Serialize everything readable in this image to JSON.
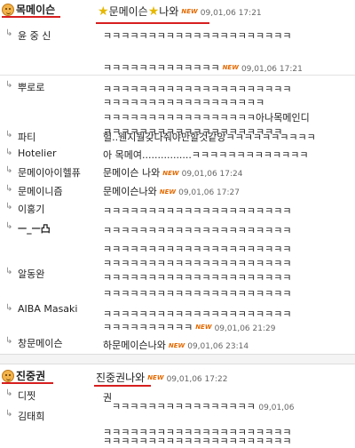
{
  "colors": {
    "underline": "#d71e1e",
    "new_badge": "#e46a00",
    "star": "#e6b800"
  },
  "icons": {
    "author": "smiley-face-icon",
    "reply": "reply-arrow-icon",
    "star": "star-icon"
  },
  "thread1": {
    "author": "목메이슨",
    "title_a": "문메이슨",
    "title_b": "나와",
    "new": "NEW",
    "time": "09,01,06 17:21",
    "replies": [
      {
        "name": "윤 중 신",
        "text": "ㅋㅋㅋㅋㅋㅋㅋㅋㅋㅋㅋㅋㅋㅋㅋㅋㅋㅋㅋㅋㅋ",
        "text2": "ㅋㅋㅋㅋㅋㅋㅋㅋㅋㅋㅋㅋㅋ",
        "new": "NEW",
        "time": "09,01,06 17:21"
      },
      {
        "name": "뿌로로",
        "text": "ㅋㅋㅋㅋㅋㅋㅋㅋㅋㅋㅋㅋㅋㅋㅋㅋㅋㅋㅋㅋㅋ",
        "text2": "ㅋㅋㅋㅋㅋㅋㅋㅋㅋㅋㅋㅋㅋㅋㅋㅋㅋㅋ",
        "text3": "ㅋㅋㅋㅋㅋㅋㅋㅋㅋㅋㅋㅋㅋㅋㅋㅋㅋ아나목메인디",
        "text4": "ㅋㅋㅋㅋㅋㅋㅋㅋㅋㅋㅋㅋㅋㅋㅋㅋㅋㅋㅋㅋ"
      },
      {
        "name": "파티",
        "text": "헐..웬지뭘갖다줘야만할것같앙ㅋㅋㅋㅋㅋㅋㅋㅋㅋㅋ"
      },
      {
        "name": "Hotelier",
        "text": "아 목메여................ㅋㅋㅋㅋㅋㅋㅋㅋㅋㅋㅋㅋㅋ"
      },
      {
        "name": "문메이아이헬퓨",
        "text": "문메이슨 나와",
        "new": "NEW",
        "time": "09,01,06 17:24"
      },
      {
        "name": "문메이니즘",
        "text": "문메이슨나와",
        "new": "NEW",
        "time": "09,01,06 17:27"
      },
      {
        "name": "이홍기",
        "text": "ㅋㅋㅋㅋㅋㅋㅋㅋㅋㅋㅋㅋㅋㅋㅋㅋㅋㅋㅋㅋㅋ"
      },
      {
        "name": "ㅡ_ㅡ凸",
        "text": "ㅋㅋㅋㅋㅋㅋㅋㅋㅋㅋㅋㅋㅋㅋㅋㅋㅋㅋㅋㅋㅋ",
        "text2": "ㅋㅋㅋㅋㅋㅋㅋㅋㅋㅋㅋㅋㅋㅋㅋㅋㅋㅋㅋㅋㅋ",
        "text3": "ㅋㅋㅋㅋㅋㅋㅋㅋㅋㅋㅋㅋㅋㅋㅋㅋㅋㅋㅋㅋㅋ"
      },
      {
        "name": "알동완",
        "text": "ㅋㅋㅋㅋㅋㅋㅋㅋㅋㅋㅋㅋㅋㅋㅋㅋㅋㅋㅋㅋㅋ",
        "text2": "ㅋㅋㅋㅋㅋㅋㅋㅋㅋㅋㅋㅋㅋㅋㅋㅋㅋㅋㅋㅋㅋ"
      },
      {
        "name": "AIBA Masaki",
        "text": "ㅋㅋㅋㅋㅋㅋㅋㅋㅋㅋㅋㅋㅋㅋㅋㅋㅋㅋㅋㅋㅋ",
        "text2": "ㅋㅋㅋㅋㅋㅋㅋㅋㅋㅋ",
        "new": "NEW",
        "time": "09,01,06 21:29"
      },
      {
        "name": "창문메이슨",
        "text": "하문메이슨나와",
        "new": "NEW",
        "time": "09,01,06 23:14"
      }
    ]
  },
  "thread2": {
    "author": "진중권",
    "title": "진중권나와",
    "new": "NEW",
    "time": "09,01,06 17:22",
    "replies": [
      {
        "name": "디찟",
        "text": "권",
        "text2": "ㅋㅋㅋㅋㅋㅋㅋㅋㅋㅋㅋㅋㅋㅋㅋㅋ",
        "time": "09,01,06"
      },
      {
        "name": "김태희",
        "text": "ㅋㅋㅋㅋㅋㅋㅋㅋㅋㅋㅋㅋㅋㅋㅋㅋㅋㅋㅋㅋㅋ",
        "text2": "ㅋㅋㅋㅋㅋㅋㅋㅋㅋㅋㅋㅋㅋㅋㅋㅋㅋㅋㅋㅋㅋ"
      }
    ]
  }
}
